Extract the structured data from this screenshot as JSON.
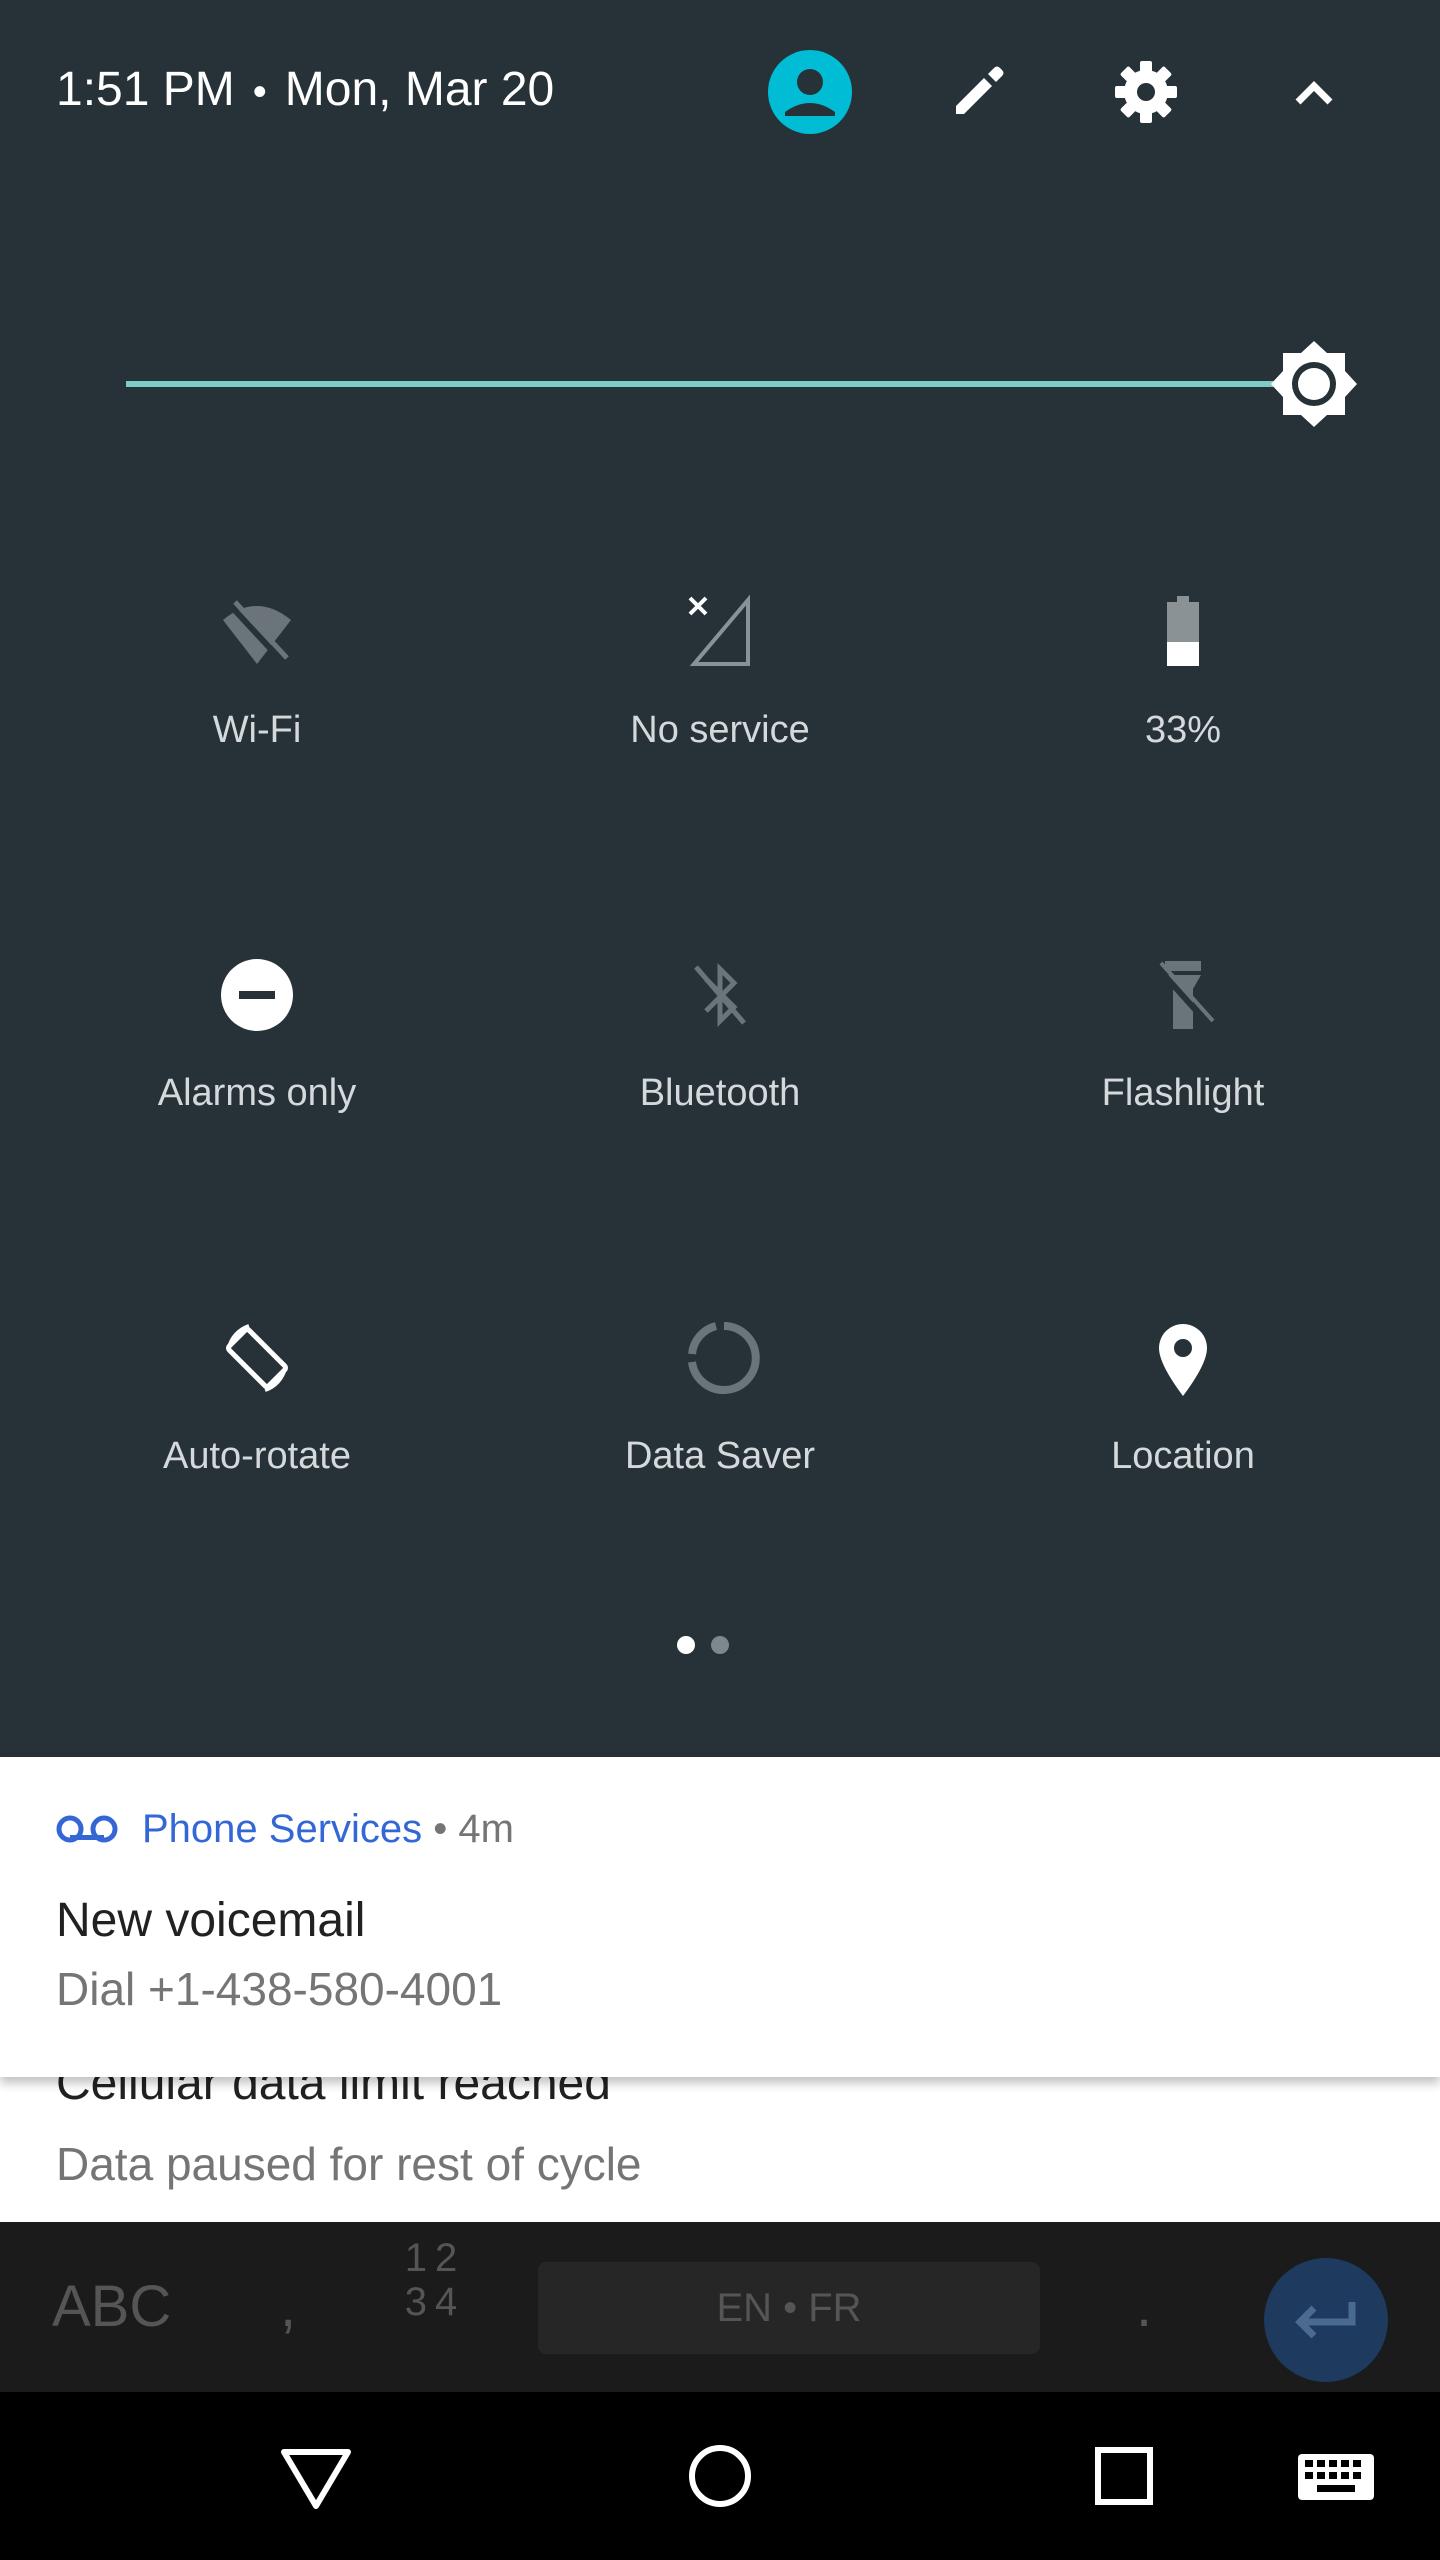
{
  "header": {
    "time": "1:51 PM",
    "separator": "•",
    "date": "Mon, Mar 20",
    "icons": [
      "account-icon",
      "edit-icon",
      "settings-icon",
      "collapse-icon"
    ]
  },
  "brightness": {
    "level": 1.0,
    "accent": "#80cbc4"
  },
  "tiles": [
    {
      "label": "Wi-Fi",
      "icon": "wifi-off-icon"
    },
    {
      "label": "No service",
      "icon": "signal-no-service-icon"
    },
    {
      "label": "33%",
      "icon": "battery-icon"
    },
    {
      "label": "Alarms only",
      "icon": "do-not-disturb-icon"
    },
    {
      "label": "Bluetooth",
      "icon": "bluetooth-off-icon"
    },
    {
      "label": "Flashlight",
      "icon": "flashlight-off-icon"
    },
    {
      "label": "Auto-rotate",
      "icon": "auto-rotate-icon"
    },
    {
      "label": "Data Saver",
      "icon": "data-saver-icon"
    },
    {
      "label": "Location",
      "icon": "location-icon"
    }
  ],
  "pager": {
    "current": 1,
    "total": 2
  },
  "notification_primary": {
    "app": "Phone Services",
    "separator": "•",
    "age": "4m",
    "title": "New voicemail",
    "body": "Dial +1-438-580-4001",
    "icon": "voicemail-icon",
    "app_color": "#3367d6"
  },
  "notification_secondary": {
    "title": "Cellular data limit reached",
    "body": "Data paused for rest of cycle"
  },
  "keyboard": {
    "abc": "ABC",
    "comma": ",",
    "numbers_top": "12",
    "numbers_bottom": "34",
    "space": "EN • FR",
    "period": ".",
    "enter_icon": "enter-icon"
  },
  "nav": [
    "back-icon",
    "home-icon",
    "recents-icon",
    "keyboard-icon"
  ],
  "colors": {
    "panel": "#263238",
    "tile_text": "#d5d9db",
    "account_accent": "#00bcd4"
  }
}
